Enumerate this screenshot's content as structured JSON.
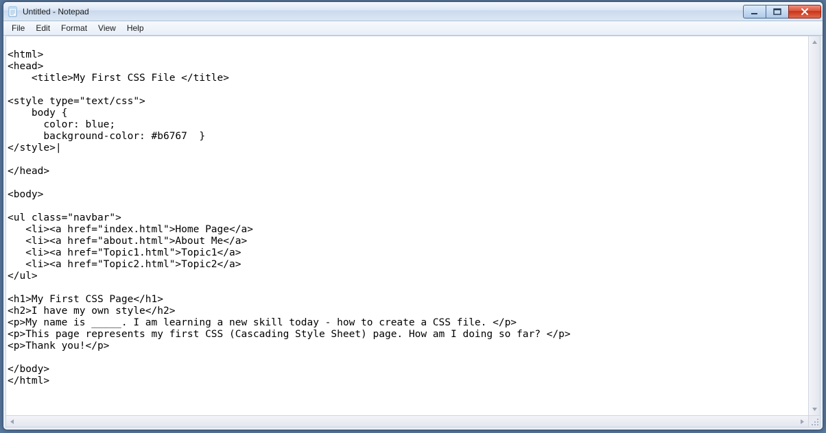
{
  "window": {
    "title": "Untitled - Notepad"
  },
  "menubar": {
    "items": [
      "File",
      "Edit",
      "Format",
      "View",
      "Help"
    ]
  },
  "editor": {
    "content": "\n<html>\n<head>\n    <title>My First CSS File </title>\n\n<style type=\"text/css\">\n    body {\n      color: blue;\n      background-color: #b6767  }\n</style>|\n\n</head>\n\n<body>\n\n<ul class=\"navbar\">\n   <li><a href=\"index.html\">Home Page</a>\n   <li><a href=\"about.html\">About Me</a>\n   <li><a href=\"Topic1.html\">Topic1</a>\n   <li><a href=\"Topic2.html\">Topic2</a>\n</ul>\n\n<h1>My First CSS Page</h1>\n<h2>I have my own style</h2>\n<p>My name is _____. I am learning a new skill today - how to create a CSS file. </p>\n<p>This page represents my first CSS (Cascading Style Sheet) page. How am I doing so far? </p>\n<p>Thank you!</p>\n\n</body>\n</html>"
  }
}
